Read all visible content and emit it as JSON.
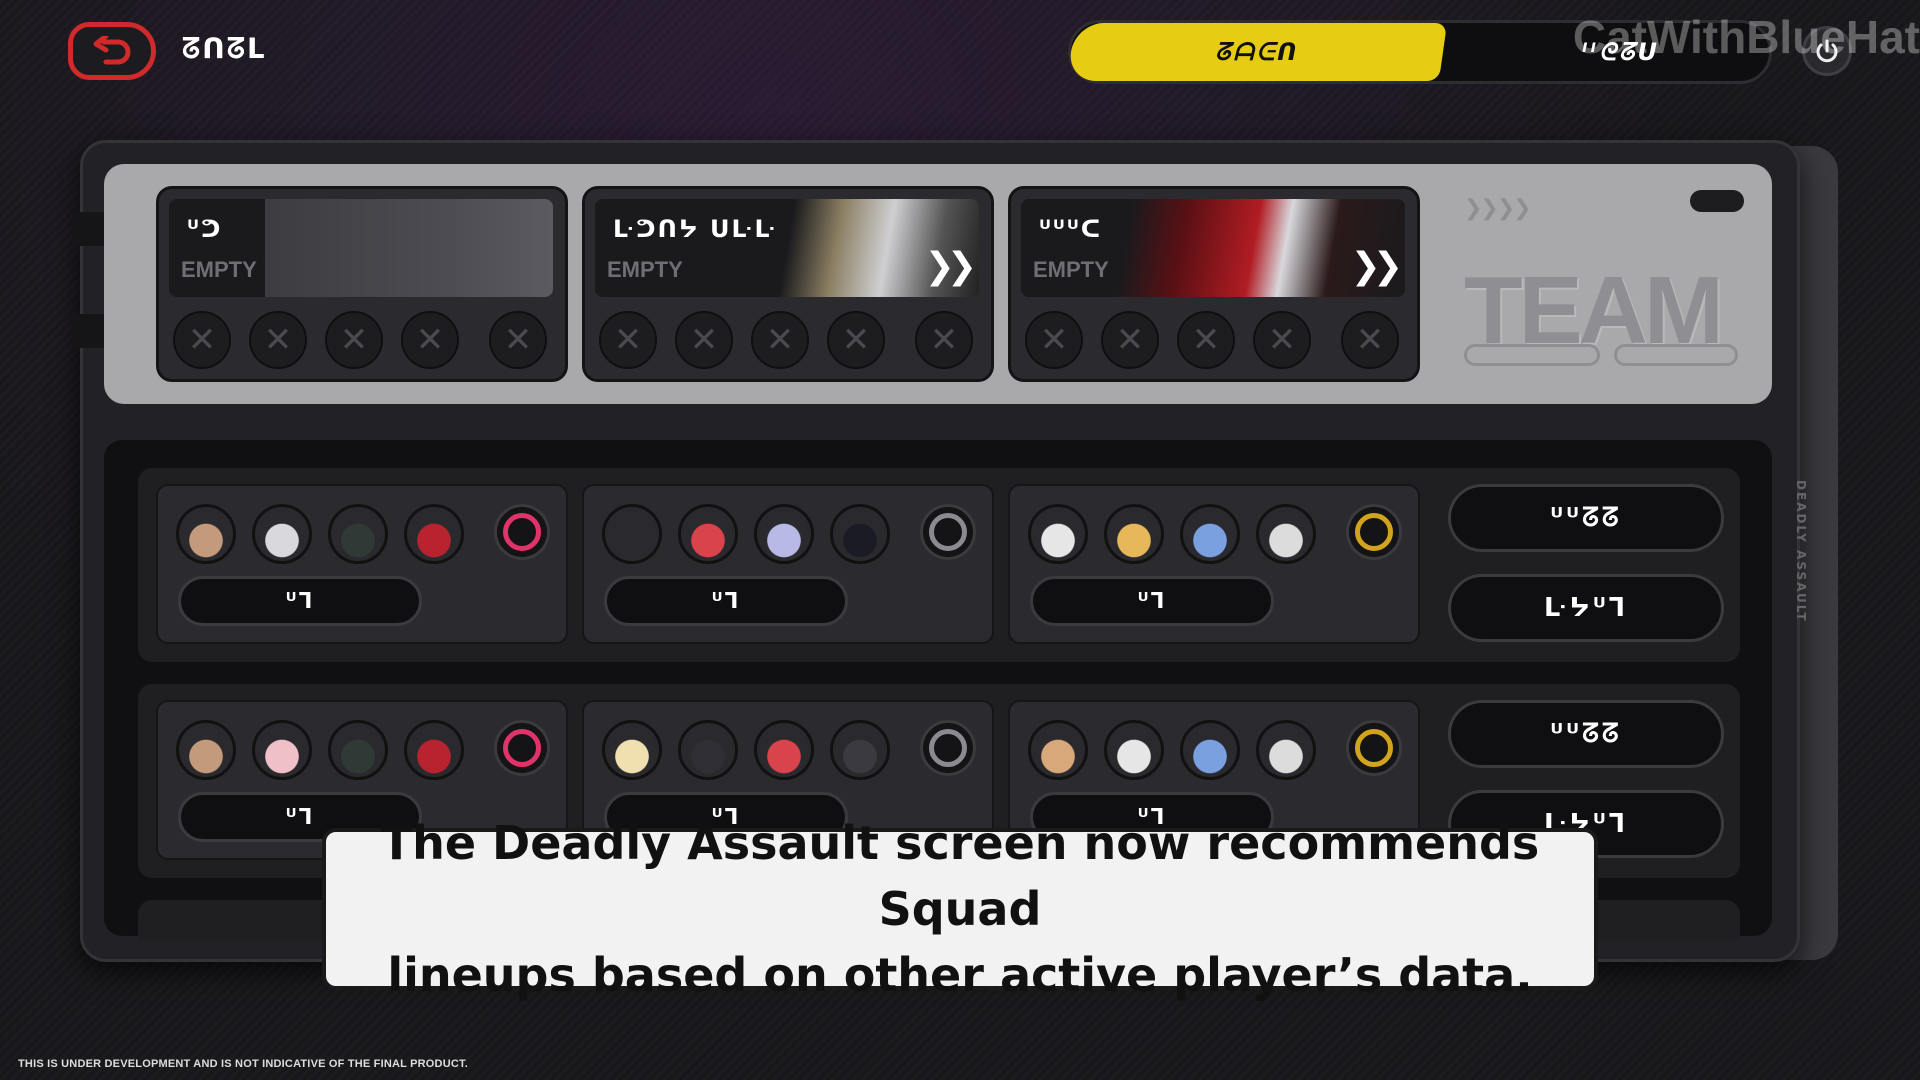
{
  "header": {
    "title": "ᘔᑎᘔᒪ",
    "watermark": "CatWithBlueHat",
    "mode_active": "ᘔᗩᕮᑎ",
    "mode_other": "ᑊᑊᘓᘔᑌ"
  },
  "slots": [
    {
      "label": "ᓑᕤ",
      "empty": "EMPTY",
      "has_arrow": false
    },
    {
      "label": "ᒷᕤᑎᔭ ᑌᒷᒷ",
      "empty": "EMPTY",
      "has_arrow": true
    },
    {
      "label": "ᓑᓑᓑᑕ",
      "empty": "EMPTY",
      "has_arrow": true
    }
  ],
  "slot_x_symbol": "✕",
  "slot_arrow_symbol": "❯❯",
  "team_deco": {
    "word": "TEAM",
    "arrows": "❯❯❯❯"
  },
  "side_text": "DEADLY ASSAULT",
  "recommendations": [
    {
      "teams": [
        {
          "use_label": "ᓑᒣ",
          "bangboo_color": "#e0336a",
          "avatars": [
            "#c49a7c",
            "#d9d9dd",
            "#2f3a36",
            "#b8232f"
          ]
        },
        {
          "use_label": "ᓑᒣ",
          "bangboo_color": "#8a8a90",
          "avatars": [
            "#2a2a2e",
            "#d9434b",
            "#b9b9e6",
            "#1b1b26"
          ]
        },
        {
          "use_label": "ᓑᒣ",
          "bangboo_color": "#d2a31c",
          "avatars": [
            "#e6e6e6",
            "#e6b85a",
            "#7aa0e0",
            "#dcdcdc"
          ]
        }
      ],
      "buttons": [
        "ᓑᓑᘔᘔ",
        "ᒷᔭᓑᒣ"
      ]
    },
    {
      "teams": [
        {
          "use_label": "ᓑᒣ",
          "bangboo_color": "#e0336a",
          "avatars": [
            "#c49a7c",
            "#f0c0c8",
            "#2f3a36",
            "#b8232f"
          ]
        },
        {
          "use_label": "ᓑᒣ",
          "bangboo_color": "#8a8a90",
          "avatars": [
            "#f0e0b0",
            "#2f2f35",
            "#d9434b",
            "#3a3a40"
          ]
        },
        {
          "use_label": "ᓑᒣ",
          "bangboo_color": "#d2a31c",
          "avatars": [
            "#d9a87a",
            "#e6e6e6",
            "#7aa0e0",
            "#dcdcdc"
          ]
        }
      ],
      "buttons": [
        "ᓑᓑᘔᘔ",
        "ᒷᔭᓑᒣ"
      ]
    }
  ],
  "subtitle": {
    "line1": "The Deadly Assault screen now recommends Squad",
    "line2": "lineups based on other active player’s data."
  },
  "disclaimer": "THIS IS UNDER DEVELOPMENT AND IS NOT INDICATIVE OF THE FINAL PRODUCT."
}
